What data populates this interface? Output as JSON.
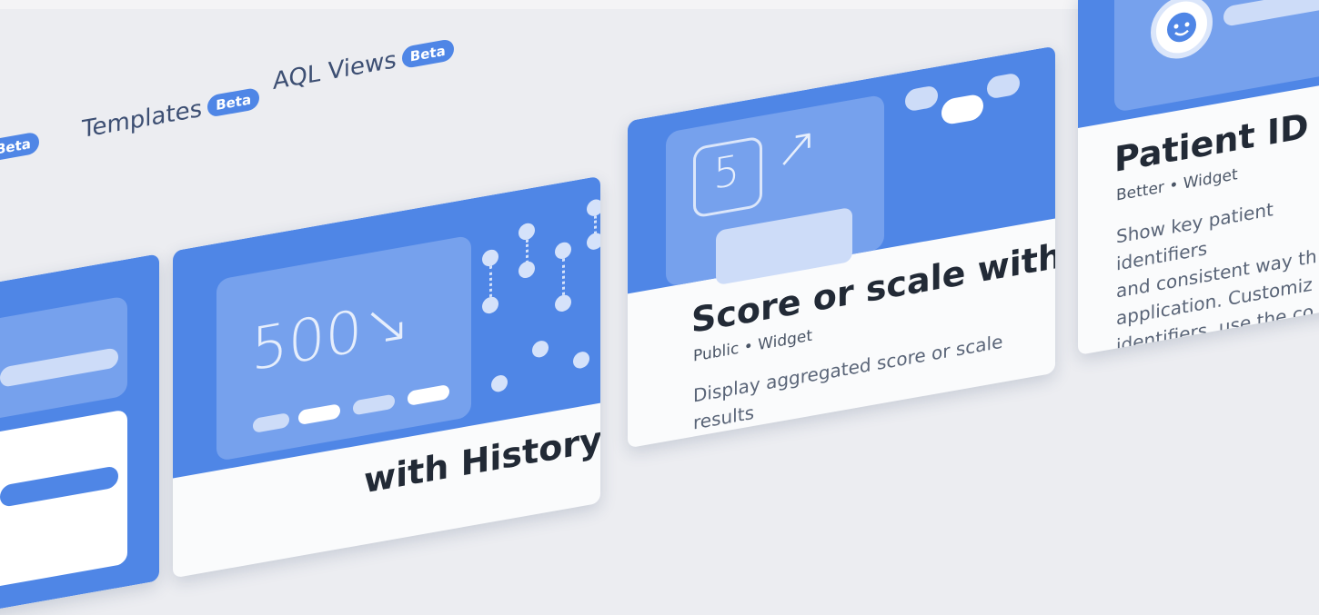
{
  "tabs": [
    {
      "label": "Beta"
    },
    {
      "label": "Templates",
      "badge": "Beta"
    },
    {
      "label": "AQL Views",
      "badge": "Beta"
    }
  ],
  "cards": {
    "history": {
      "big_value": "500",
      "arrow": "↘",
      "title": "with History"
    },
    "score": {
      "big_value": "5",
      "arrow": "↗",
      "title": "Score or scale with history",
      "visibility": "Public",
      "type": "Widget",
      "description": "Display aggregated score or scale results\nin a format with colour-coded\nand a history chart.\nshowing"
    },
    "patient": {
      "title": "Patient ID",
      "visibility": "Better",
      "type": "Widget",
      "description": "Show key patient identifiers\nand consistent way th\napplication. Customiz\nidentifiers, use the co\nsymbol, set the date\nbuilding patient ban"
    }
  },
  "colors": {
    "accent": "#4f86e6",
    "panel": "#76a1ed",
    "background": "#ecedf1"
  },
  "icons": {
    "avatar": "smiley-avatar-icon"
  }
}
